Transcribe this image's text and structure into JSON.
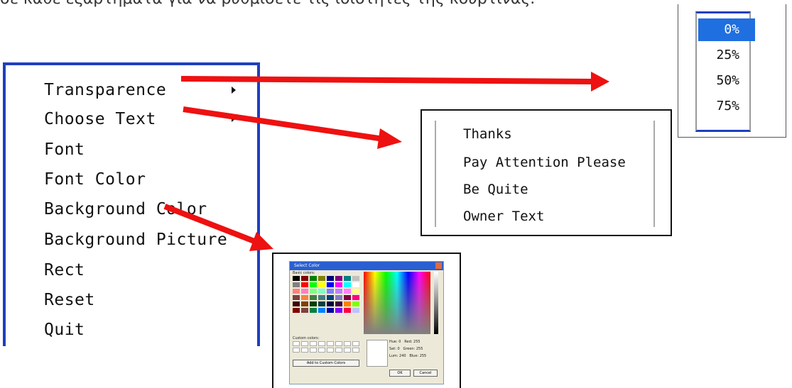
{
  "header": {
    "text": "σε κάθε εξαρτήματα για να ρυθμίσετε τις ιδιότητες της κουρτίνας."
  },
  "main_menu": {
    "items": [
      {
        "label": "Transparence",
        "has_submenu": true
      },
      {
        "label": "Choose Text",
        "has_submenu": true
      },
      {
        "label": "Font"
      },
      {
        "label": "Font Color"
      },
      {
        "label": "Background Color"
      },
      {
        "label": "Background Picture"
      },
      {
        "label": "Rect"
      },
      {
        "label": "Reset"
      },
      {
        "label": "Quit"
      }
    ]
  },
  "transparence_menu": {
    "items": [
      "0%",
      "25%",
      "50%",
      "75%"
    ],
    "selected": "0%"
  },
  "text_menu": {
    "items": [
      "Thanks",
      "Pay Attention Please",
      "Be Quite",
      "Owner Text"
    ]
  },
  "color_dialog": {
    "title": "Select Color",
    "basic_colors_label": "Basic colors:",
    "custom_colors_label": "Custom colors:",
    "add_custom_label": "Add to Custom Colors",
    "ok_label": "OK",
    "cancel_label": "Cancel",
    "hue_label": "Hue:",
    "hue_value": "0",
    "sat_label": "Sat:",
    "sat_value": "0",
    "lum_label": "Lum:",
    "lum_value": "240",
    "red_label": "Red:",
    "red_value": "255",
    "green_label": "Green:",
    "green_value": "255",
    "blue_label": "Blue:",
    "blue_value": "255",
    "basic_colors": [
      "#000000",
      "#800000",
      "#008000",
      "#808000",
      "#000080",
      "#800080",
      "#008080",
      "#c0c0c0",
      "#808080",
      "#ff0000",
      "#00ff00",
      "#ffff00",
      "#0000ff",
      "#ff00ff",
      "#00ffff",
      "#ffffff",
      "#ff8080",
      "#ff80c0",
      "#80ff80",
      "#80ffc0",
      "#8080ff",
      "#c080ff",
      "#ff80ff",
      "#ffff80",
      "#804040",
      "#ff8040",
      "#408040",
      "#408080",
      "#004080",
      "#8080c0",
      "#800040",
      "#ff0080",
      "#400000",
      "#804000",
      "#004000",
      "#004040",
      "#000040",
      "#400040",
      "#ff8000",
      "#80ff00",
      "#800000",
      "#804040",
      "#008040",
      "#0080ff",
      "#0000a0",
      "#8000ff",
      "#ff0040",
      "#c0c0ff"
    ]
  },
  "colors": {
    "menu_border": "#1e3fbf",
    "arrow": "#ee1111",
    "selection": "#1f6fe0"
  }
}
